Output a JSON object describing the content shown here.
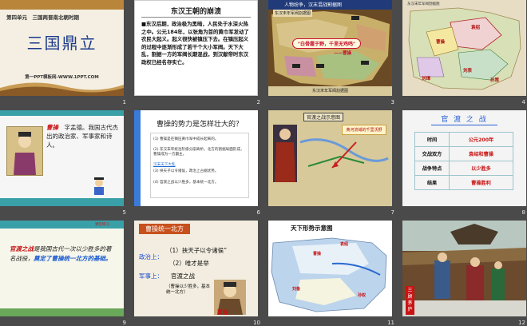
{
  "window": {
    "title": "三国鼎立 slide sorter"
  },
  "slides": [
    {
      "num": "1",
      "unit": "第四单元　三国两晋南北朝时期",
      "title": "三国鼎立",
      "site": "第一PPT模板网-WWW.1PPT.COM"
    },
    {
      "num": "2",
      "title": "东汉王朝的崩溃",
      "body": "东汉后期，政治极为黑暗，人民处于水深火热之中。公元184年，以张角为首的黄巾军发动了农民大起义。起义很快被镇压下去。在镇压起义的过程中逐渐形成了若干个大小军阀。天下大乱，割据一方的军阀长期混战，到汉献帝时东汉政权已经名存实亡。"
    },
    {
      "num": "3",
      "header": "人物纷争，汉末混战割据图",
      "map_title": "东汉末年军阀割据图",
      "banner": "\"白骨露于野，千里无鸡鸣\"",
      "attribution": "——曹操",
      "caption": "东汉末年军阀割据图"
    },
    {
      "num": "4",
      "map_title": "东汉末年军阀割据图",
      "labels": [
        "袁绍",
        "曹操",
        "刘表",
        "孙策",
        "刘璋"
      ]
    },
    {
      "num": "5",
      "name": "曹操",
      "text": "字孟德。我国古代杰出的政治家、军事家和诗人。"
    },
    {
      "num": "6",
      "title": "曹操的势力是怎样壮大的？",
      "items": [
        "(1) 曹操是在镇压黄巾军中成长起来的。",
        "(2) 东汉末年统治阶级分崩离析，北方的割据局面形成，曹操成为一方霸主。",
        "(3) 挟天子以令诸侯，政治上占据优势。",
        "(4) 官渡之战以少胜多，基本统一北方。"
      ],
      "highlight": "汉末天下大乱"
    },
    {
      "num": "7",
      "title": "官渡之战示意图",
      "note": "黄河流域的千里沃野"
    },
    {
      "num": "8",
      "title": "官 渡 之 战",
      "rows": [
        {
          "k": "时间",
          "v": "公元200年"
        },
        {
          "k": "交战双方",
          "v": "袁绍和曹操"
        },
        {
          "k": "战争特点",
          "v": "以少胜多"
        },
        {
          "k": "结果",
          "v": "曹操胜利"
        }
      ]
    },
    {
      "num": "9",
      "tag": "课堂练习",
      "red1": "官渡之战",
      "t1": "是我国古代一次以少胜多的著名战役，",
      "blue": "奠定了曹操统一北方的基础。"
    },
    {
      "num": "10",
      "title": "曹操统一北方",
      "politics_label": "政治上：",
      "p1": "（1）挟天子以令诸侯”",
      "p2": "（2）唯才是举",
      "military_label": "军事上：",
      "m1": "官渡之战",
      "m2": "（曹操以少胜多，基本统一北方）",
      "caption": "曹操"
    },
    {
      "num": "11",
      "title": "天下形势示意图",
      "labels": [
        "曹操",
        "孙权",
        "刘备",
        "袁绍"
      ]
    },
    {
      "num": "12",
      "vertical": "三顾茅庐"
    }
  ]
}
